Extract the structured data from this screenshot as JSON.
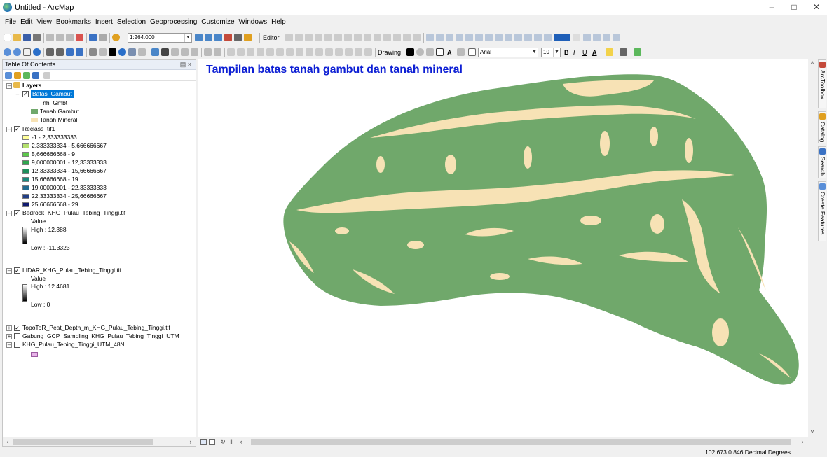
{
  "window": {
    "title": "Untitled - ArcMap"
  },
  "menu": [
    "File",
    "Edit",
    "View",
    "Bookmarks",
    "Insert",
    "Selection",
    "Geoprocessing",
    "Customize",
    "Windows",
    "Help"
  ],
  "toolbar": {
    "scale_value": "1:264.000",
    "editor_label": "Editor",
    "drawing_label": "Drawing",
    "font_name": "Arial",
    "font_size": "10",
    "bold": "B",
    "italic": "I",
    "underline": "U",
    "font_color_letter": "A"
  },
  "toc": {
    "title": "Table Of Contents",
    "root": "Layers",
    "batas": {
      "name": "Batas_Gambut",
      "field": "Tnh_Gmbt",
      "classes": [
        {
          "label": "Tanah Gambut",
          "color": "#70a86b"
        },
        {
          "label": "Tanah Mineral",
          "color": "#f7e2b5"
        }
      ]
    },
    "reclass": {
      "name": "Reclass_tif1",
      "classes": [
        {
          "label": "-1 - 2,333333333",
          "color": "#ffff99"
        },
        {
          "label": "2,333333334 - 5,666666667",
          "color": "#b4e06e"
        },
        {
          "label": "5,666666668 - 9",
          "color": "#5cc84a"
        },
        {
          "label": "9,000000001 - 12,33333333",
          "color": "#2fa64f"
        },
        {
          "label": "12,33333334 - 15,66666667",
          "color": "#1f8f5c"
        },
        {
          "label": "15,66666668 - 19",
          "color": "#1b8a7c"
        },
        {
          "label": "19,00000001 - 22,33333333",
          "color": "#226b8e"
        },
        {
          "label": "22,33333334 - 25,66666667",
          "color": "#223f86"
        },
        {
          "label": "25,66666668 - 29",
          "color": "#101a70"
        }
      ]
    },
    "bedrock": {
      "name": "Bedrock_KHG_Pulau_Tebing_Tinggi.tif",
      "value_label": "Value",
      "high": "High : 12.388",
      "low": "Low : -11.3323"
    },
    "lidar": {
      "name": "LIDAR_KHG_Pulau_Tebing_Tinggi.tif",
      "value_label": "Value",
      "high": "High : 12.4681",
      "low": "Low : 0"
    },
    "topo": {
      "name": "TopoToR_Peat_Depth_m_KHG_Pulau_Tebing_Tinggi.tif"
    },
    "gabung": {
      "name": "Gabung_GCP_Sampling_KHG_Pulau_Tebing_Tinggi_UTM_"
    },
    "khg": {
      "name": "KHG_Pulau_Tebing_Tinggi_UTM_48N",
      "swatch_color": "#e7b3e8"
    }
  },
  "map": {
    "title": "Tampilan batas tanah gambut dan tanah mineral",
    "peat_color": "#70a86b",
    "mineral_color": "#f7e2b5"
  },
  "dock": [
    "ArcToolbox",
    "Catalog",
    "Search",
    "Create Features"
  ],
  "status": {
    "coordinates": "102.673  0.846 Decimal Degrees"
  }
}
